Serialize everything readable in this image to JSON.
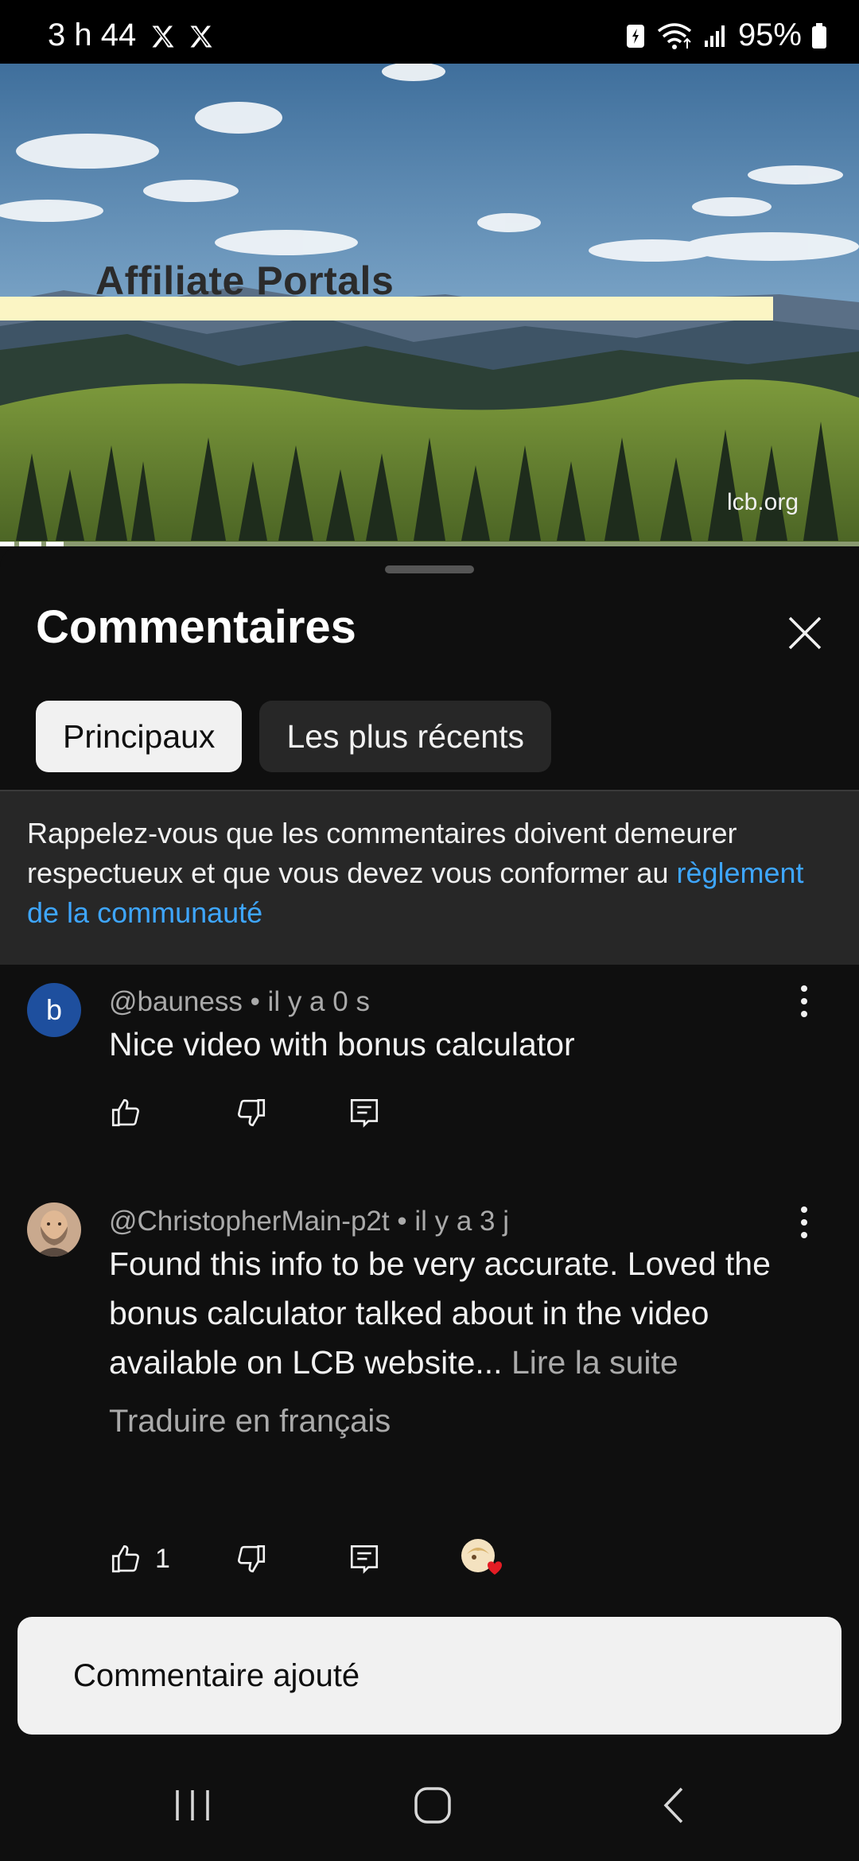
{
  "status_bar": {
    "time": "3 h 44",
    "notification_icons": [
      "x-logo-icon",
      "x-logo-icon"
    ],
    "battery": "95%"
  },
  "video": {
    "overlay_title": "Affiliate Portals",
    "watermark": "lcb.org"
  },
  "comments_panel": {
    "title": "Commentaires",
    "tabs": [
      {
        "label": "Principaux",
        "active": true
      },
      {
        "label": "Les plus récents",
        "active": false
      }
    ],
    "notice": {
      "text": "Rappelez-vous que les commentaires doivent demeurer respectueux et que vous devez vous conformer au ",
      "link": "règlement de la communauté"
    },
    "comments": [
      {
        "avatar_letter": "b",
        "author": "@bauness",
        "time": " • il y a 0 s",
        "text": "Nice video with bonus calculator",
        "likes": ""
      },
      {
        "avatar_letter": "",
        "author": "@ChristopherMain-p2t",
        "time": " • il y a 3 j",
        "text": "Found this info to be very accurate. Loved the bonus calculator talked about in the video available on LCB website...",
        "read_more": " Lire la suite",
        "translate": "Traduire en français",
        "likes": "1"
      }
    ]
  },
  "snackbar": {
    "message": "Commentaire ajouté"
  },
  "colors": {
    "background": "#0f0f0f",
    "surface": "#272727",
    "link": "#3ea6ff",
    "secondary_text": "#aaaaaa"
  }
}
